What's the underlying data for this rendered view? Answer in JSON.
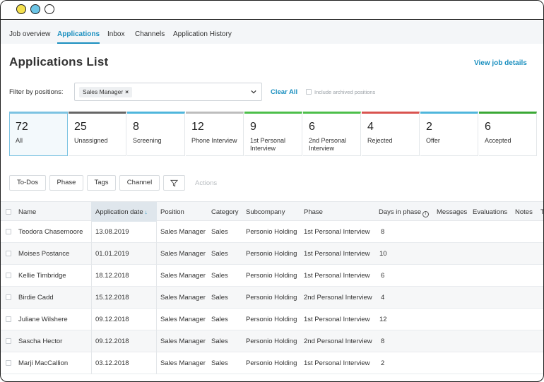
{
  "nav": {
    "tabs": [
      {
        "label": "Job overview"
      },
      {
        "label": "Applications"
      },
      {
        "label": "Inbox"
      },
      {
        "label": "Channels"
      },
      {
        "label": "Application History"
      }
    ],
    "active_tab": "Applications"
  },
  "header": {
    "title": "Applications List",
    "view_details": "View job details"
  },
  "filter": {
    "label": "Filter by positions:",
    "chip": "Sales Manager",
    "chip_remove": "×",
    "clear_all": "Clear All",
    "archived_label": "Include archived positions"
  },
  "stages": [
    {
      "count": "72",
      "name": "All",
      "color": "#7cc3e2"
    },
    {
      "count": "25",
      "name": "Unassigned",
      "color": "#666666"
    },
    {
      "count": "8",
      "name": "Screening",
      "color": "#4fb6dc"
    },
    {
      "count": "12",
      "name": "Phone Interview",
      "color": "#bdbdbd"
    },
    {
      "count": "9",
      "name": "1st Personal Interview",
      "color": "#4cbf4a"
    },
    {
      "count": "6",
      "name": "2nd Personal Interview",
      "color": "#4cbf4a"
    },
    {
      "count": "4",
      "name": "Rejected",
      "color": "#d9534f"
    },
    {
      "count": "2",
      "name": "Offer",
      "color": "#4fb6dc"
    },
    {
      "count": "6",
      "name": "Accepted",
      "color": "#3aa835"
    }
  ],
  "toolbar": {
    "todos": "To-Dos",
    "phase": "Phase",
    "tags": "Tags",
    "channel": "Channel",
    "actions": "Actions"
  },
  "table": {
    "headers": {
      "name": "Name",
      "application_date": "Application date",
      "position": "Position",
      "category": "Category",
      "subcompany": "Subcompany",
      "phase": "Phase",
      "days_in_phase": "Days in phase",
      "messages": "Messages",
      "evaluations": "Evaluations",
      "notes": "Notes",
      "overflow": "T"
    },
    "sort_indicator": "↓",
    "info_glyph": "i",
    "rows": [
      {
        "name": "Teodora Chasemoore",
        "date": "13.08.2019",
        "position": "Sales Manager",
        "category": "Sales",
        "subcompany": "Personio Holding",
        "phase": "1st Personal Interview",
        "days": "8"
      },
      {
        "name": "Moises Postance",
        "date": "01.01.2019",
        "position": "Sales Manager",
        "category": "Sales",
        "subcompany": "Personio Holding",
        "phase": "1st Personal Interview",
        "days": "10"
      },
      {
        "name": "Kellie Timbridge",
        "date": "18.12.2018",
        "position": "Sales Manager",
        "category": "Sales",
        "subcompany": "Personio Holding",
        "phase": "1st Personal Interview",
        "days": "6"
      },
      {
        "name": "Birdie Cadd",
        "date": "15.12.2018",
        "position": "Sales Manager",
        "category": "Sales",
        "subcompany": "Personio Holding",
        "phase": "2nd Personal Interview",
        "days": "4"
      },
      {
        "name": "Juliane Wilshere",
        "date": "09.12.2018",
        "position": "Sales Manager",
        "category": "Sales",
        "subcompany": "Personio Holding",
        "phase": "1st Personal Interview",
        "days": "12"
      },
      {
        "name": "Sascha Hector",
        "date": "09.12.2018",
        "position": "Sales Manager",
        "category": "Sales",
        "subcompany": "Personio Holding",
        "phase": "2nd Personal Interview",
        "days": "8"
      },
      {
        "name": "Marji MacCallion",
        "date": "03.12.2018",
        "position": "Sales Manager",
        "category": "Sales",
        "subcompany": "Personio Holding",
        "phase": "1st Personal Interview",
        "days": "2"
      }
    ]
  },
  "colors": {
    "accent": "#1a8fbf",
    "window_dot_yellow": "#f4e04d",
    "window_dot_blue": "#6cc5e6"
  }
}
